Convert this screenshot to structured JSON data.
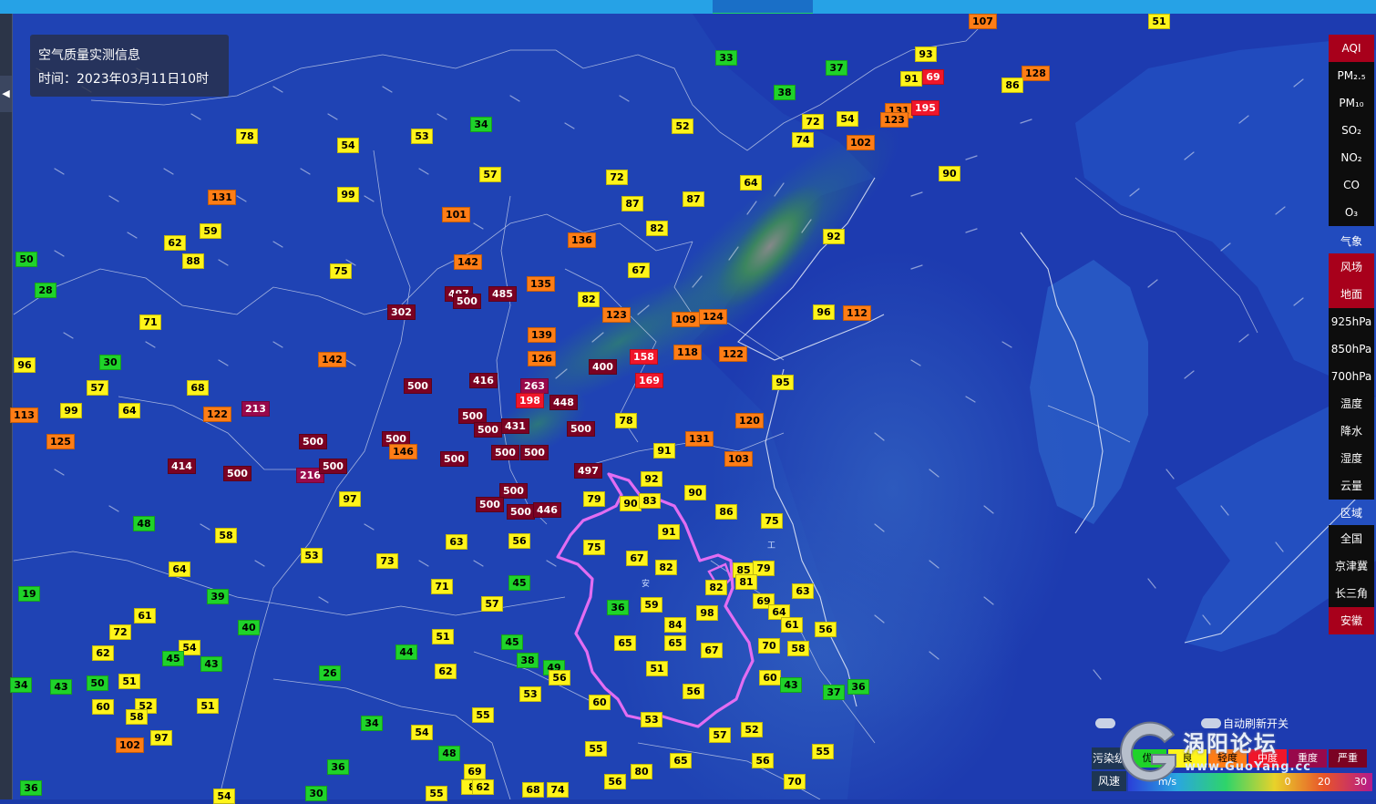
{
  "info": {
    "title": "空气质量实测信息",
    "time": "时间：2023年03月11日10时"
  },
  "colors": {
    "good": "#1fd32a",
    "moderate": "#fff41a",
    "usg": "#ff7d16",
    "unhealthy": "#f0162a",
    "very_unhealthy": "#98094b",
    "hazardous": "#7b0223",
    "active": "#a8001b"
  },
  "stations": [
    [
      "107",
      1063,
      15,
      3
    ],
    [
      "51",
      1260,
      15,
      2
    ],
    [
      "33",
      785,
      55,
      1
    ],
    [
      "93",
      1004,
      51,
      2
    ],
    [
      "37",
      906,
      66,
      1
    ],
    [
      "91",
      988,
      78,
      2
    ],
    [
      "69",
      1012,
      76,
      4
    ],
    [
      "128",
      1121,
      72,
      3
    ],
    [
      "86",
      1099,
      85,
      2
    ],
    [
      "38",
      849,
      93,
      1
    ],
    [
      "131",
      971,
      113,
      3
    ],
    [
      "195",
      1000,
      110,
      4
    ],
    [
      "123",
      966,
      123,
      3
    ],
    [
      "72",
      880,
      125,
      2
    ],
    [
      "54",
      918,
      122,
      2
    ],
    [
      "74",
      869,
      145,
      2
    ],
    [
      "102",
      929,
      148,
      3
    ],
    [
      "34",
      516,
      128,
      1
    ],
    [
      "53",
      451,
      141,
      2
    ],
    [
      "78",
      259,
      141,
      2
    ],
    [
      "54",
      370,
      151,
      2
    ],
    [
      "52",
      737,
      130,
      2
    ],
    [
      "57",
      526,
      183,
      2
    ],
    [
      "72",
      665,
      186,
      2
    ],
    [
      "64",
      812,
      192,
      2
    ],
    [
      "90",
      1030,
      182,
      2
    ],
    [
      "87",
      682,
      215,
      2
    ],
    [
      "87",
      749,
      210,
      2
    ],
    [
      "131",
      228,
      208,
      3
    ],
    [
      "99",
      370,
      205,
      2
    ],
    [
      "101",
      485,
      227,
      3
    ],
    [
      "82",
      709,
      242,
      2
    ],
    [
      "59",
      219,
      245,
      2
    ],
    [
      "62",
      180,
      258,
      2
    ],
    [
      "88",
      200,
      278,
      2
    ],
    [
      "136",
      623,
      255,
      3
    ],
    [
      "92",
      903,
      251,
      2
    ],
    [
      "142",
      498,
      279,
      3
    ],
    [
      "75",
      362,
      289,
      2
    ],
    [
      "67",
      689,
      288,
      2
    ],
    [
      "50",
      17,
      276,
      1
    ],
    [
      "28",
      38,
      310,
      1
    ],
    [
      "497",
      488,
      314,
      6
    ],
    [
      "500",
      497,
      322,
      6
    ],
    [
      "485",
      536,
      314,
      6
    ],
    [
      "135",
      578,
      303,
      3
    ],
    [
      "82",
      634,
      320,
      2
    ],
    [
      "302",
      425,
      334,
      6
    ],
    [
      "123",
      661,
      337,
      3
    ],
    [
      "109",
      737,
      342,
      3
    ],
    [
      "124",
      767,
      339,
      3
    ],
    [
      "96",
      892,
      334,
      2
    ],
    [
      "112",
      925,
      335,
      3
    ],
    [
      "71",
      153,
      345,
      2
    ],
    [
      "139",
      579,
      359,
      3
    ],
    [
      "126",
      579,
      385,
      3
    ],
    [
      "158",
      691,
      383,
      4
    ],
    [
      "118",
      739,
      378,
      3
    ],
    [
      "122",
      789,
      380,
      3
    ],
    [
      "142",
      349,
      386,
      3
    ],
    [
      "96",
      15,
      392,
      2
    ],
    [
      "30",
      109,
      389,
      1
    ],
    [
      "400",
      646,
      394,
      6
    ],
    [
      "169",
      697,
      409,
      4
    ],
    [
      "95",
      847,
      411,
      2
    ],
    [
      "416",
      515,
      409,
      6
    ],
    [
      "263",
      571,
      415,
      5
    ],
    [
      "198",
      566,
      431,
      4
    ],
    [
      "448",
      603,
      433,
      6
    ],
    [
      "500",
      443,
      415,
      6
    ],
    [
      "57",
      95,
      417,
      2
    ],
    [
      "68",
      205,
      417,
      2
    ],
    [
      "113",
      11,
      447,
      3
    ],
    [
      "99",
      66,
      442,
      2
    ],
    [
      "64",
      130,
      442,
      2
    ],
    [
      "213",
      265,
      440,
      5
    ],
    [
      "122",
      223,
      446,
      3
    ],
    [
      "500",
      503,
      448,
      6
    ],
    [
      "431",
      550,
      459,
      6
    ],
    [
      "500",
      520,
      463,
      6
    ],
    [
      "500",
      622,
      462,
      6
    ],
    [
      "78",
      675,
      453,
      2
    ],
    [
      "131",
      752,
      473,
      3
    ],
    [
      "120",
      807,
      453,
      3
    ],
    [
      "125",
      51,
      476,
      3
    ],
    [
      "500",
      419,
      473,
      6
    ],
    [
      "146",
      427,
      487,
      3
    ],
    [
      "500",
      328,
      476,
      6
    ],
    [
      "500",
      483,
      495,
      6
    ],
    [
      "500",
      539,
      488,
      6
    ],
    [
      "500",
      571,
      488,
      6
    ],
    [
      "91",
      717,
      486,
      2
    ],
    [
      "103",
      795,
      495,
      3
    ],
    [
      "414",
      184,
      503,
      6
    ],
    [
      "500",
      245,
      511,
      6
    ],
    [
      "216",
      325,
      513,
      5
    ],
    [
      "500",
      350,
      503,
      6
    ],
    [
      "497",
      630,
      508,
      6
    ],
    [
      "92",
      703,
      517,
      2
    ],
    [
      "97",
      372,
      539,
      2
    ],
    [
      "500",
      548,
      530,
      6
    ],
    [
      "500",
      522,
      545,
      6
    ],
    [
      "500",
      556,
      553,
      6
    ],
    [
      "446",
      585,
      551,
      6
    ],
    [
      "79",
      640,
      539,
      2
    ],
    [
      "90",
      680,
      544,
      2
    ],
    [
      "83",
      701,
      541,
      2
    ],
    [
      "90",
      751,
      532,
      2
    ],
    [
      "86",
      785,
      553,
      2
    ],
    [
      "75",
      835,
      563,
      2
    ],
    [
      "48",
      146,
      566,
      1
    ],
    [
      "58",
      236,
      579,
      2
    ],
    [
      "91",
      722,
      575,
      2
    ],
    [
      "63",
      489,
      586,
      2
    ],
    [
      "56",
      558,
      585,
      2
    ],
    [
      "75",
      640,
      592,
      2
    ],
    [
      "53",
      330,
      601,
      2
    ],
    [
      "73",
      413,
      607,
      2
    ],
    [
      "64",
      185,
      616,
      2
    ],
    [
      "67",
      687,
      604,
      2
    ],
    [
      "82",
      719,
      614,
      2
    ],
    [
      "85",
      804,
      617,
      2
    ],
    [
      "79",
      826,
      615,
      2
    ],
    [
      "81",
      807,
      630,
      2
    ],
    [
      "82",
      774,
      636,
      2
    ],
    [
      "19",
      20,
      643,
      1
    ],
    [
      "71",
      473,
      635,
      2
    ],
    [
      "45",
      558,
      631,
      1
    ],
    [
      "63",
      869,
      640,
      2
    ],
    [
      "39",
      227,
      646,
      1
    ],
    [
      "57",
      528,
      654,
      2
    ],
    [
      "36",
      666,
      658,
      1
    ],
    [
      "59",
      703,
      655,
      2
    ],
    [
      "98",
      764,
      664,
      2
    ],
    [
      "69",
      826,
      651,
      2
    ],
    [
      "64",
      843,
      663,
      2
    ],
    [
      "61",
      147,
      667,
      2
    ],
    [
      "72",
      120,
      685,
      2
    ],
    [
      "40",
      261,
      680,
      1
    ],
    [
      "84",
      729,
      677,
      2
    ],
    [
      "61",
      857,
      677,
      2
    ],
    [
      "56",
      894,
      682,
      2
    ],
    [
      "51",
      474,
      690,
      2
    ],
    [
      "54",
      196,
      702,
      2
    ],
    [
      "65",
      674,
      697,
      2
    ],
    [
      "65",
      729,
      697,
      2
    ],
    [
      "67",
      769,
      705,
      2
    ],
    [
      "70",
      832,
      700,
      2
    ],
    [
      "58",
      864,
      703,
      2
    ],
    [
      "45",
      550,
      696,
      1
    ],
    [
      "62",
      101,
      708,
      2
    ],
    [
      "45",
      178,
      714,
      1
    ],
    [
      "43",
      220,
      720,
      1
    ],
    [
      "44",
      434,
      707,
      1
    ],
    [
      "38",
      567,
      716,
      1
    ],
    [
      "49",
      596,
      724,
      1
    ],
    [
      "56",
      602,
      735,
      2
    ],
    [
      "51",
      709,
      725,
      2
    ],
    [
      "62",
      477,
      728,
      2
    ],
    [
      "26",
      350,
      730,
      1
    ],
    [
      "60",
      833,
      735,
      2
    ],
    [
      "43",
      856,
      743,
      1
    ],
    [
      "34",
      11,
      743,
      1
    ],
    [
      "43",
      55,
      745,
      1
    ],
    [
      "50",
      95,
      741,
      1
    ],
    [
      "51",
      130,
      739,
      2
    ],
    [
      "37",
      903,
      751,
      1
    ],
    [
      "36",
      930,
      745,
      1
    ],
    [
      "53",
      570,
      753,
      2
    ],
    [
      "56",
      749,
      750,
      2
    ],
    [
      "60",
      101,
      767,
      2
    ],
    [
      "52",
      148,
      766,
      2
    ],
    [
      "51",
      216,
      766,
      2
    ],
    [
      "60",
      646,
      762,
      2
    ],
    [
      "58",
      138,
      778,
      2
    ],
    [
      "55",
      518,
      776,
      2
    ],
    [
      "53",
      703,
      781,
      2
    ],
    [
      "34",
      396,
      785,
      1
    ],
    [
      "54",
      451,
      795,
      2
    ],
    [
      "57",
      778,
      798,
      2
    ],
    [
      "52",
      813,
      792,
      2
    ],
    [
      "97",
      165,
      801,
      2
    ],
    [
      "102",
      127,
      809,
      3
    ],
    [
      "55",
      642,
      813,
      2
    ],
    [
      "55",
      891,
      816,
      2
    ],
    [
      "48",
      481,
      818,
      1
    ],
    [
      "65",
      735,
      826,
      2
    ],
    [
      "56",
      825,
      826,
      2
    ],
    [
      "36",
      359,
      833,
      1
    ],
    [
      "69",
      509,
      838,
      2
    ],
    [
      "80",
      692,
      838,
      2
    ],
    [
      "56",
      663,
      849,
      2
    ],
    [
      "8",
      506,
      855,
      2
    ],
    [
      "62",
      518,
      855,
      2
    ],
    [
      "68",
      573,
      858,
      2
    ],
    [
      "74",
      600,
      858,
      2
    ],
    [
      "70",
      860,
      849,
      2
    ],
    [
      "36",
      22,
      856,
      1
    ],
    [
      "30",
      335,
      862,
      1
    ],
    [
      "54",
      234,
      865,
      2
    ],
    [
      "55",
      467,
      862,
      2
    ]
  ],
  "panel": {
    "pollutants": [
      "AQI",
      "PM₂.₅",
      "PM₁₀",
      "SO₂",
      "NO₂",
      "CO",
      "O₃"
    ],
    "weather_header": "气象",
    "weather": [
      "风场",
      "地面",
      "925hPa",
      "850hPa",
      "700hPa",
      "温度",
      "降水",
      "湿度",
      "云量"
    ],
    "region_header": "区域",
    "regions": [
      "全国",
      "京津冀",
      "长三角",
      "安徽"
    ]
  },
  "toggle": {
    "label": "自动刷新开关"
  },
  "legend": {
    "row1_label": "污染级别",
    "levels": [
      "优",
      "良",
      "轻度",
      "中度",
      "重度",
      "严重"
    ],
    "row2_label": "风速",
    "unit": "m/s",
    "ticks": [
      "0",
      "20",
      "30"
    ]
  },
  "watermark": {
    "text": "涡阳论坛",
    "url": "www.GuoYang.cc"
  }
}
